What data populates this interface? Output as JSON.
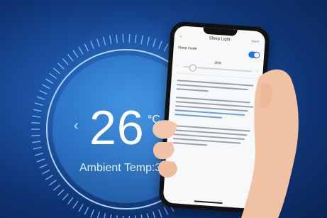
{
  "display": {
    "temperature": "26",
    "unit": "°C",
    "ambient": "Ambient Temp:3",
    "prev_symbol": "‹"
  },
  "phone": {
    "title": "Sleep Light",
    "save": "Save",
    "back_icon": "chevron-left-icon",
    "sleep_mode_label": "Sleep mode",
    "sleep_toggle_on": true,
    "value_label": "30%"
  },
  "colors": {
    "background": "#1a4f9e",
    "accent": "#1a73e8",
    "text": "#ffffff"
  }
}
